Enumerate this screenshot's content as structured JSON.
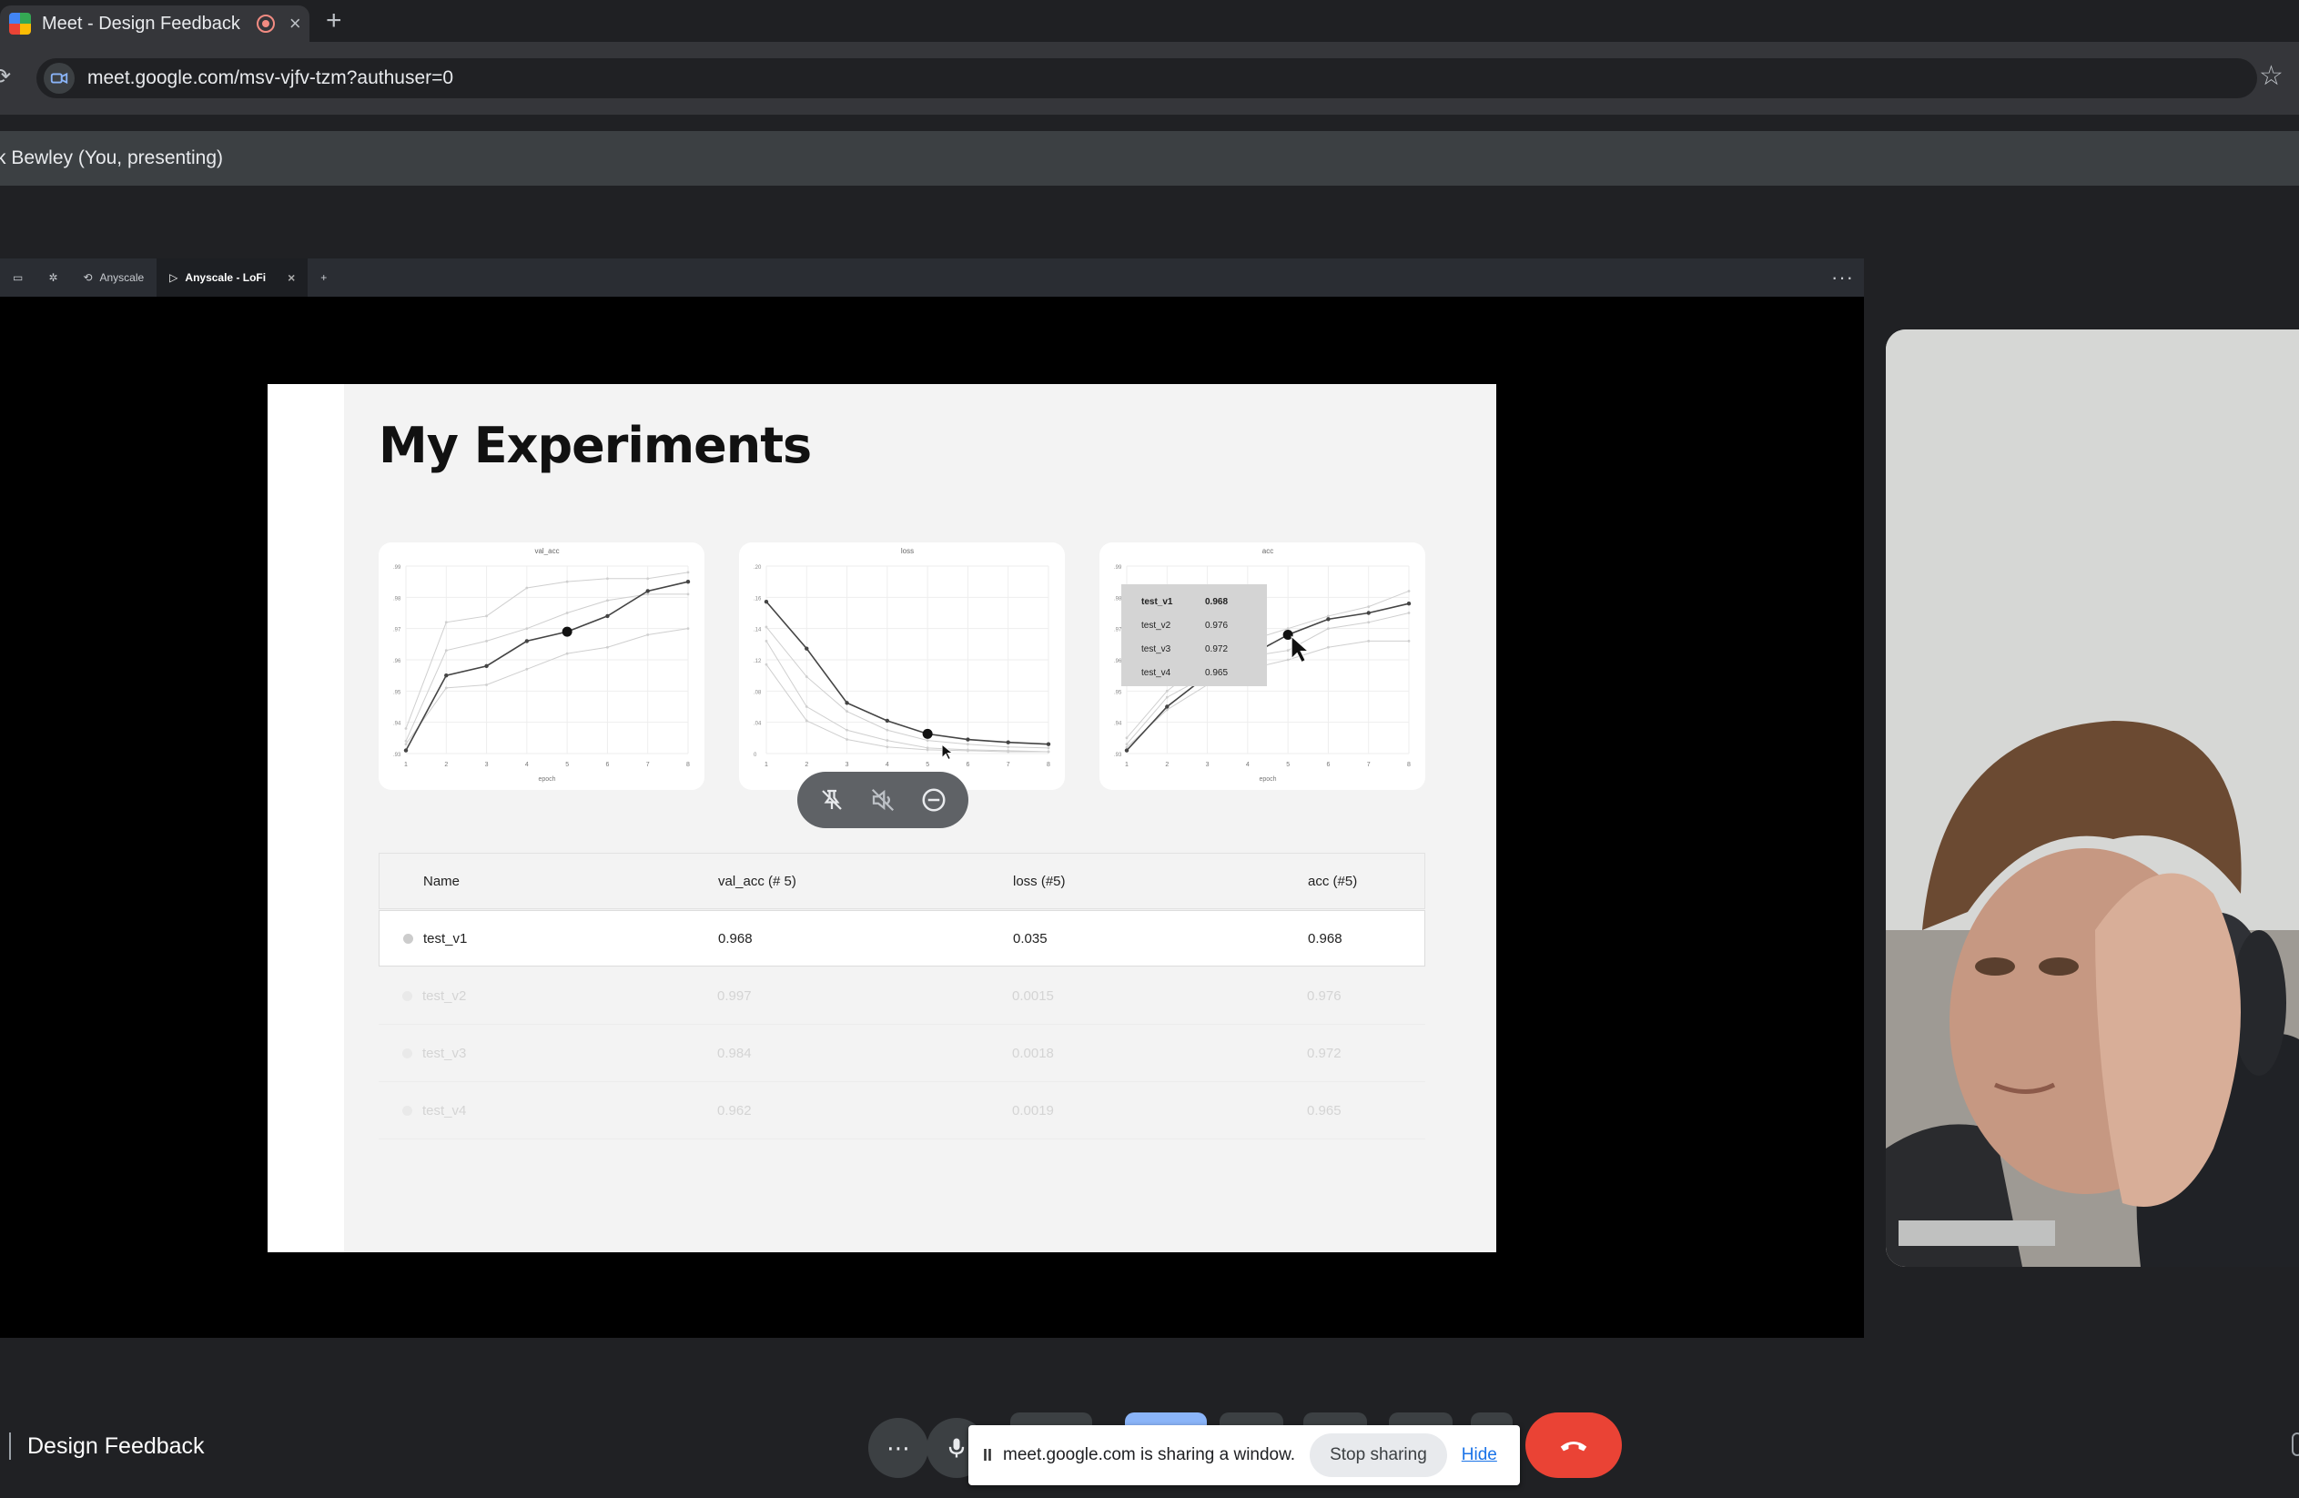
{
  "browser": {
    "tab_title": "Meet - Design Feedback",
    "tab_close": "×",
    "new_tab": "+",
    "url": "meet.google.com/msv-vjfv-tzm?authuser=0"
  },
  "presenting": {
    "label": "k Bewley (You, presenting)"
  },
  "shared_window": {
    "tabs": [
      {
        "label": "Anyscale"
      },
      {
        "label": "Anyscale - LoFi"
      }
    ],
    "tab_close": "×",
    "new_tab": "+",
    "more": "···"
  },
  "slide": {
    "title": "My Experiments",
    "table": {
      "headers": [
        "Name",
        "val_acc (# 5)",
        "loss (#5)",
        "acc (#5)"
      ],
      "rows": [
        [
          "test_v1",
          "0.968",
          "0.035",
          "0.968"
        ],
        [
          "test_v2",
          "0.997",
          "0.0015",
          "0.976"
        ],
        [
          "test_v3",
          "0.984",
          "0.0018",
          "0.972"
        ],
        [
          "test_v4",
          "0.962",
          "0.0019",
          "0.965"
        ]
      ]
    }
  },
  "chart_data": [
    {
      "type": "line",
      "title": "val_acc",
      "xlabel": "epoch",
      "x": [
        1,
        2,
        3,
        4,
        5,
        6,
        7,
        8
      ],
      "yticks": [
        ".93",
        ".94",
        ".95",
        ".96",
        ".97",
        ".98",
        ".99"
      ],
      "ylim": [
        0.93,
        0.99
      ],
      "highlight_index": 4,
      "series": [
        {
          "values": [
            0.931,
            0.955,
            0.958,
            0.966,
            0.969,
            0.974,
            0.982,
            0.985
          ]
        },
        {
          "values": [
            0.938,
            0.972,
            0.974,
            0.983,
            0.985,
            0.986,
            0.986,
            0.988
          ]
        },
        {
          "values": [
            0.934,
            0.963,
            0.966,
            0.97,
            0.975,
            0.979,
            0.981,
            0.981
          ]
        },
        {
          "values": [
            0.933,
            0.951,
            0.952,
            0.957,
            0.962,
            0.964,
            0.968,
            0.97
          ]
        }
      ]
    },
    {
      "type": "line",
      "title": "loss",
      "xlabel": "epoch",
      "x": [
        1,
        2,
        3,
        4,
        5,
        6,
        7,
        8
      ],
      "yticks": [
        "0",
        ".04",
        ".08",
        ".12",
        ".14",
        ".16",
        ".20"
      ],
      "ylim": [
        0,
        0.2
      ],
      "highlight_index": 4,
      "series": [
        {
          "values": [
            0.162,
            0.112,
            0.054,
            0.035,
            0.021,
            0.015,
            0.012,
            0.01
          ]
        },
        {
          "values": [
            0.135,
            0.082,
            0.045,
            0.025,
            0.014,
            0.01,
            0.007,
            0.006
          ]
        },
        {
          "values": [
            0.12,
            0.05,
            0.025,
            0.014,
            0.006,
            0.004,
            0.003,
            0.002
          ]
        },
        {
          "values": [
            0.095,
            0.035,
            0.015,
            0.007,
            0.004,
            0.003,
            0.002,
            0.002
          ]
        }
      ]
    },
    {
      "type": "line",
      "title": "acc",
      "xlabel": "epoch",
      "x": [
        1,
        2,
        3,
        4,
        5,
        6,
        7,
        8
      ],
      "yticks": [
        ".93",
        ".94",
        ".95",
        ".96",
        ".97",
        ".98",
        ".99"
      ],
      "ylim": [
        0.93,
        0.99
      ],
      "highlight_index": 4,
      "series": [
        {
          "values": [
            0.931,
            0.945,
            0.955,
            0.961,
            0.968,
            0.973,
            0.975,
            0.978
          ]
        },
        {
          "values": [
            0.935,
            0.95,
            0.96,
            0.966,
            0.97,
            0.974,
            0.977,
            0.982
          ]
        },
        {
          "values": [
            0.933,
            0.948,
            0.955,
            0.961,
            0.963,
            0.97,
            0.972,
            0.975
          ]
        },
        {
          "values": [
            0.932,
            0.944,
            0.952,
            0.957,
            0.96,
            0.964,
            0.966,
            0.966
          ]
        }
      ],
      "tooltip": [
        {
          "name": "test_v1",
          "value": "0.968"
        },
        {
          "name": "test_v2",
          "value": "0.976"
        },
        {
          "name": "test_v3",
          "value": "0.972"
        },
        {
          "name": "test_v4",
          "value": "0.965"
        }
      ]
    }
  ],
  "meeting": {
    "name": "Design Feedback",
    "more": "⋯",
    "share_notice": "meet.google.com is sharing a window.",
    "pause": "II",
    "stop_sharing": "Stop sharing",
    "hide": "Hide"
  },
  "colors": {
    "end_call": "#ea4335",
    "link": "#1a73e8",
    "chart_primary": "#444444",
    "chart_secondary": "#cfcfcf"
  }
}
